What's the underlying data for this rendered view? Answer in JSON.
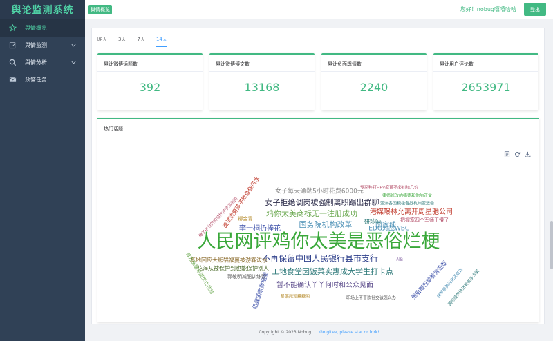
{
  "brand": "舆论监测系统",
  "sidebar": {
    "items": [
      {
        "label": "舆情概览",
        "icon": "star-icon",
        "active": true
      },
      {
        "label": "舆情监测",
        "icon": "edit-icon",
        "expandable": true
      },
      {
        "label": "舆情分析",
        "icon": "search-icon",
        "expandable": true
      },
      {
        "label": "预警任务",
        "icon": "mail-icon"
      }
    ]
  },
  "header": {
    "tag": "舆情概览",
    "greeting": "您好！nobug嘻嘻哈哈",
    "logout": "登出"
  },
  "tabs": [
    {
      "label": "昨天"
    },
    {
      "label": "3天"
    },
    {
      "label": "7天"
    },
    {
      "label": "14天",
      "active": true
    }
  ],
  "stats": [
    {
      "label": "累计微博话题数",
      "value": "392"
    },
    {
      "label": "累计微博博文数",
      "value": "13168"
    },
    {
      "label": "累计负面舆情数",
      "value": "2240"
    },
    {
      "label": "累计用户评论数",
      "value": "2653971"
    }
  ],
  "hot_topics": {
    "title": "热门话题",
    "words": [
      {
        "text": "人民网评鸡你太美是恶俗烂梗",
        "color": "#3aa83a"
      },
      {
        "text": "不再保留中国人民银行县市支行",
        "color": "#2c3e8a"
      },
      {
        "text": "工地食堂因饭菜实惠成大学生打卡点",
        "color": "#2f7a7a"
      },
      {
        "text": "鸡你太美商标无一注册成功",
        "color": "#6aa84f"
      },
      {
        "text": "国务院机构改革",
        "color": "#4a8fb5"
      },
      {
        "text": "国家线",
        "color": "#4a8fb5"
      },
      {
        "text": "女子拒绝调岗被强制离职踢出群聊",
        "color": "#2c2c4a"
      },
      {
        "text": "女子每天通勤5小时花费6000元",
        "color": "#8a8a8a"
      },
      {
        "text": "李一桐扔捧花",
        "color": "#3a4ea8"
      },
      {
        "text": "港媒曝林允离开周星驰公司",
        "color": "#c0392b"
      },
      {
        "text": "EDG对战WBG",
        "color": "#4a8fb5"
      },
      {
        "text": "暂不能确认丫丫何时和公众见面",
        "color": "#5a4a8a"
      },
      {
        "text": "研珍呐",
        "color": "#2f7a7a"
      },
      {
        "text": "把握塞四个军师干懵了",
        "color": "#b5506a"
      },
      {
        "text": "柳金青",
        "color": "#b58a2a"
      },
      {
        "text": "基地回应大熊猫福蔓被游客泼水",
        "color": "#8a6a2a"
      },
      {
        "text": "花海从被保护到也能保护别人",
        "color": "#4a6a2a"
      },
      {
        "text": "郭敬明减肥训练营",
        "color": "#5a5a5a"
      },
      {
        "text": "专家称打HPV疫苗不必纠结几价",
        "color": "#b5506a"
      },
      {
        "text": "律师修改的摘要和你的正文",
        "color": "#3aa83a"
      },
      {
        "text": "亚洲各国积极备战杭州亚运会",
        "color": "#2f7a7a"
      },
      {
        "text": "A股",
        "color": "#8a6aa8"
      },
      {
        "text": "星落起现糟糖阁",
        "color": "#b58a2a"
      },
      {
        "text": "职场上不喜欢社交该怎么办",
        "color": "#5a5a5a"
      },
      {
        "text": "面试选男孩子就像做风水",
        "color": "#c0392b"
      },
      {
        "text": "俺了中台的的话把孩子消苦的",
        "color": "#b5506a"
      },
      {
        "text": "曾为保暴帝国死亡往坊",
        "color": "#6aa84f"
      },
      {
        "text": "组建国家数据局",
        "color": "#3a4ea8"
      },
      {
        "text": "张伯爾巴黎看秀造型",
        "color": "#3a4ea8"
      },
      {
        "text": "俄罗斯美元化正在去",
        "color": "#4a8fb5"
      },
      {
        "text": "国际级的经济有很多方案",
        "color": "#2f7a7a"
      }
    ]
  },
  "footer": {
    "copyright": "Copyright © 2023 Nobug",
    "link": "Go gitee, please star or fork!"
  }
}
